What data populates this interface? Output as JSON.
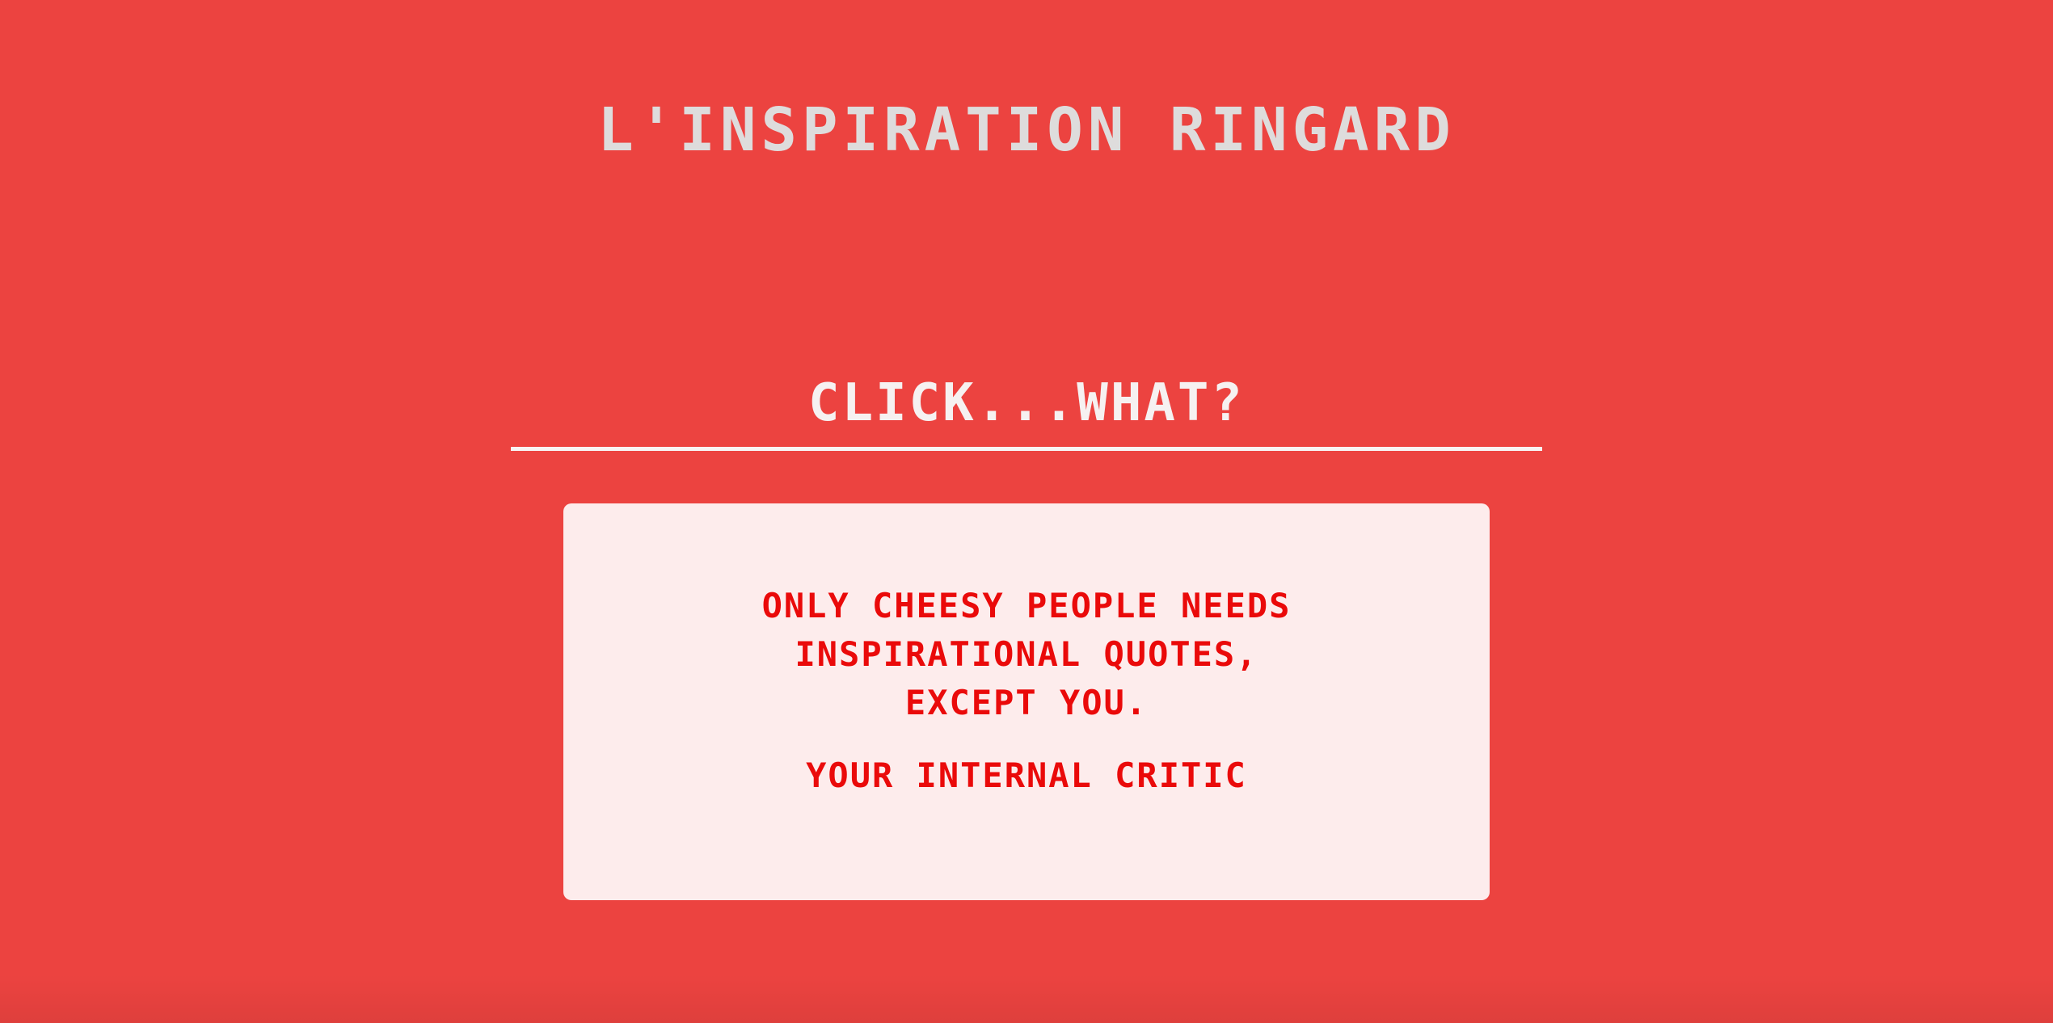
{
  "page": {
    "title": "L'INSPIRATION RINGARD"
  },
  "prompt": {
    "label": "CLICK...WHAT?"
  },
  "quote": {
    "lines": [
      "ONLY CHEESY PEOPLE NEEDS",
      "INSPIRATIONAL QUOTES,",
      "EXCEPT YOU."
    ],
    "author": "YOUR INTERNAL CRITIC"
  },
  "colors": {
    "background": "#ec4340",
    "title_text": "#dedcdc",
    "prompt_text": "#f6f1f1",
    "card_background": "#fdecec",
    "quote_text": "#ea0a0a"
  }
}
